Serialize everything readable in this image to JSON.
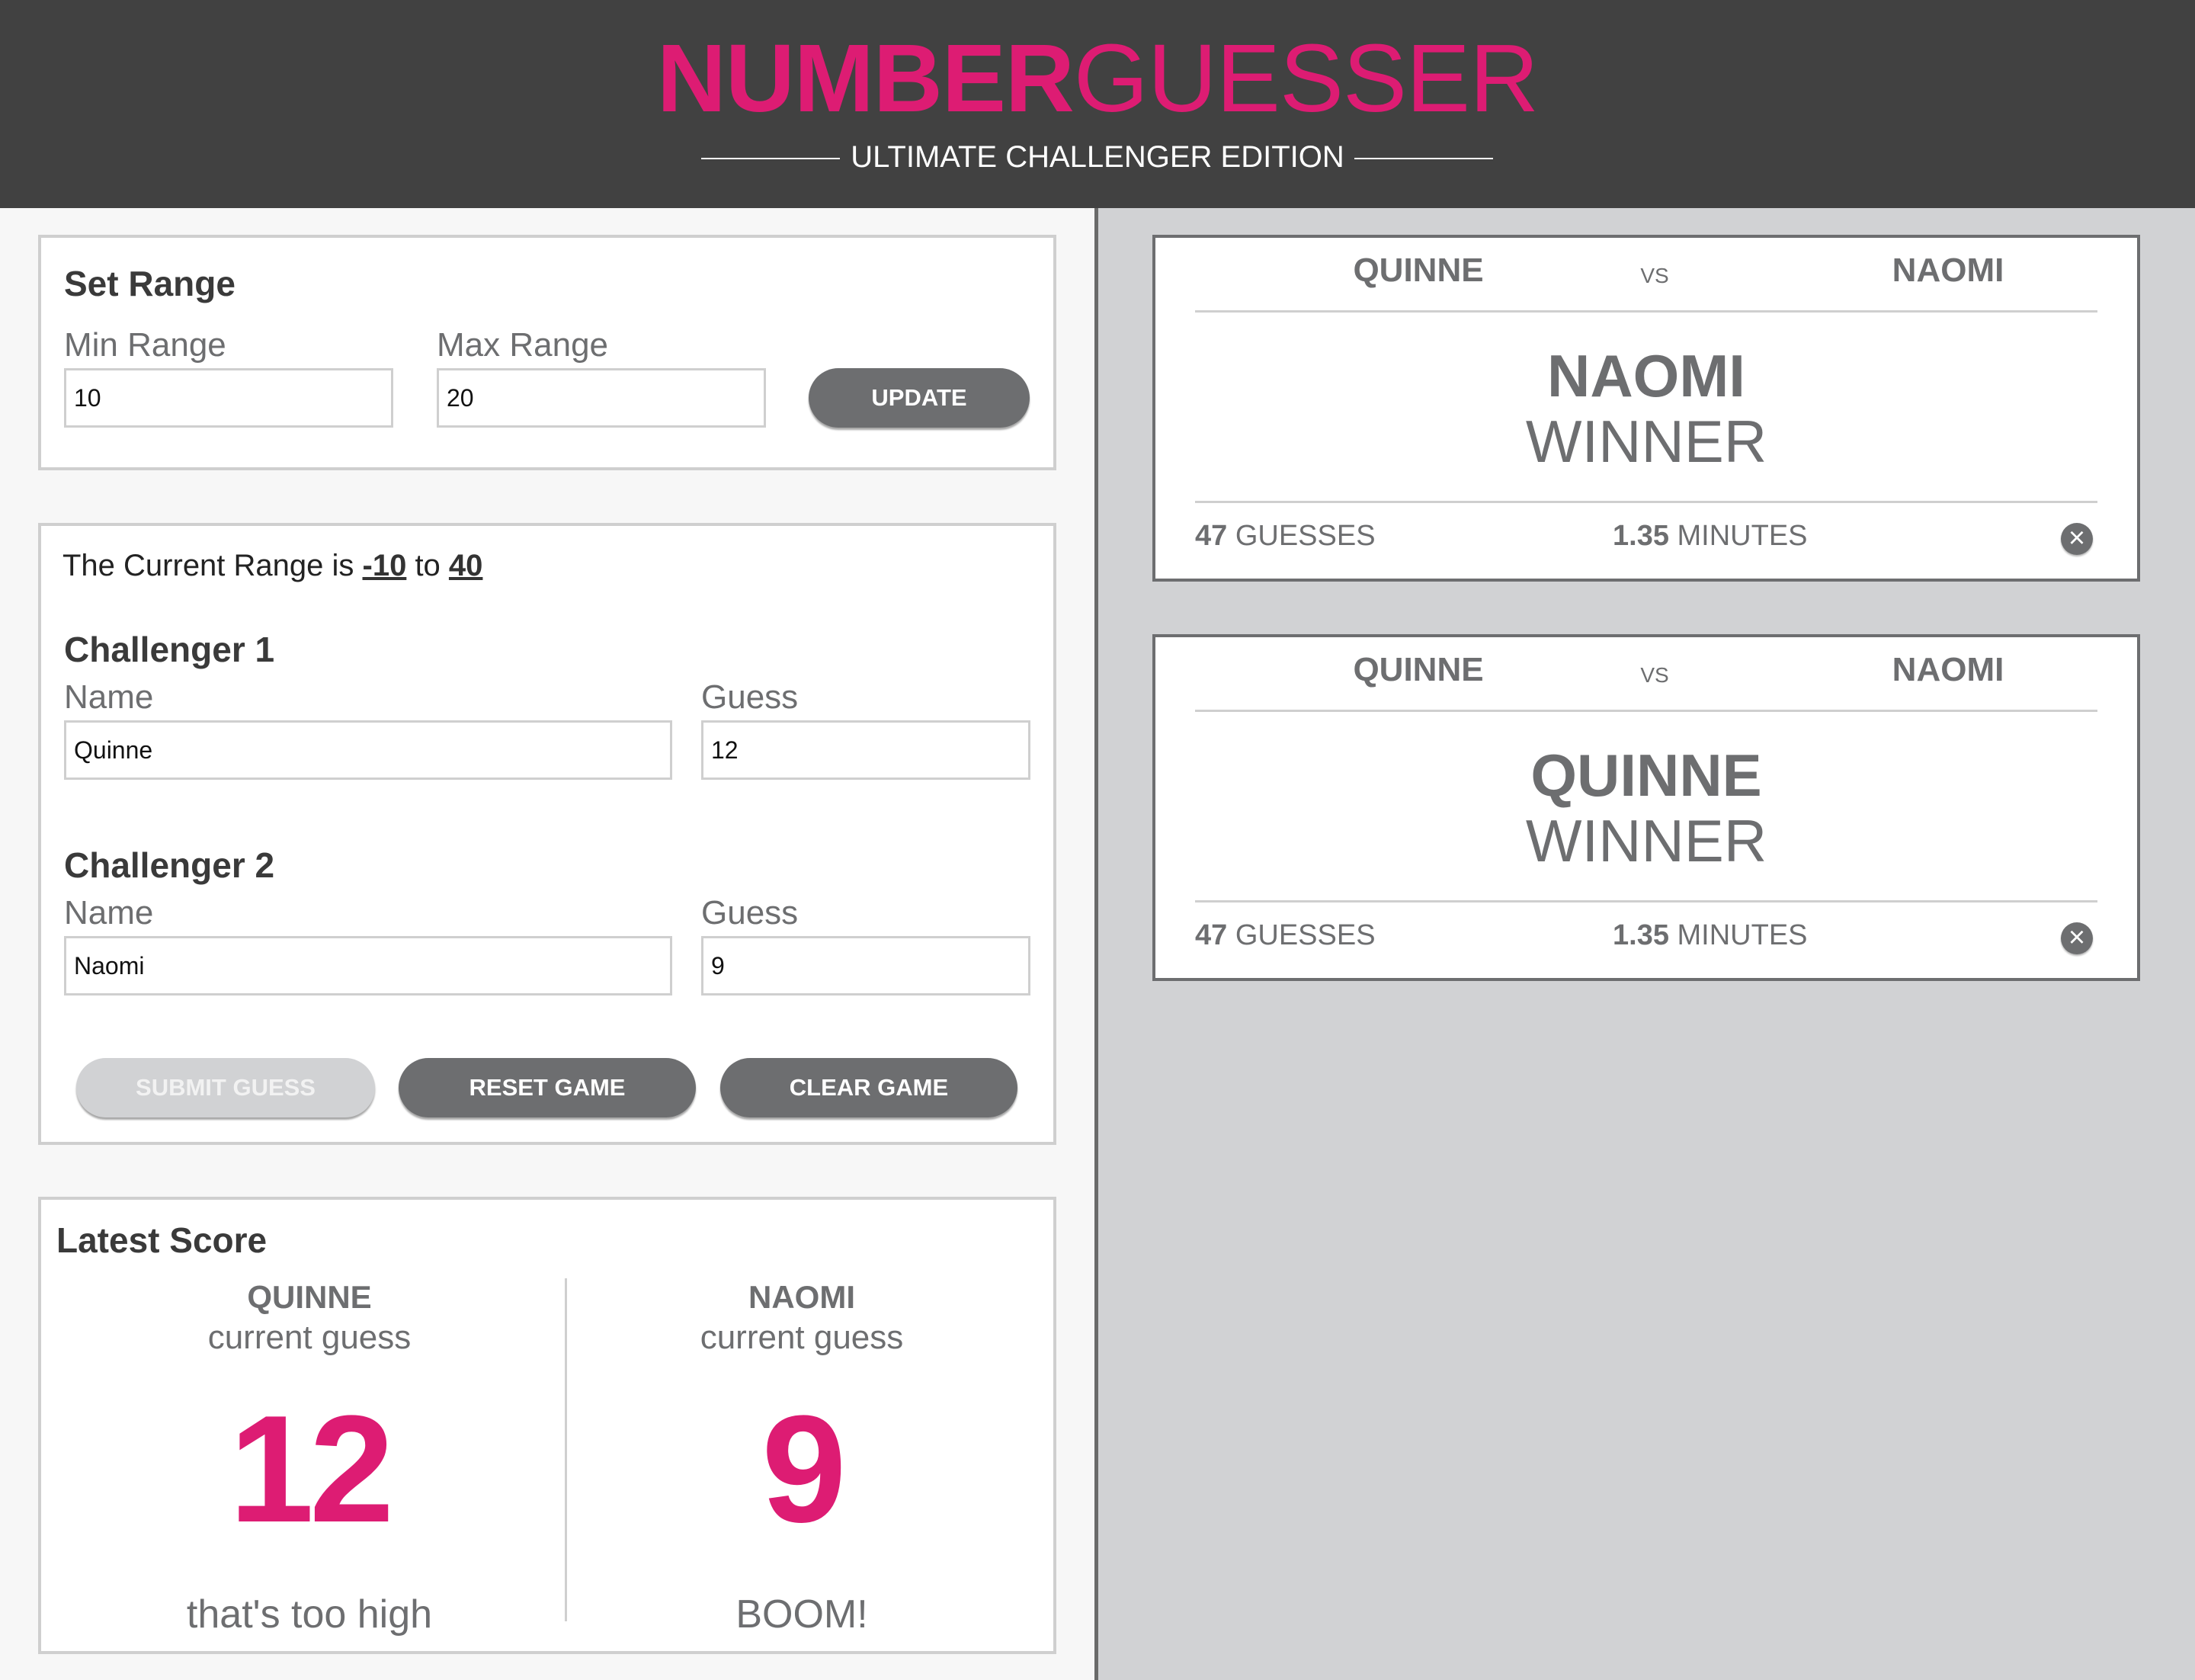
{
  "header": {
    "title_bold": "NUMBER",
    "title_light": "GUESSER",
    "subtitle": "ULTIMATE CHALLENGER EDITION"
  },
  "colors": {
    "accent": "#dd1c73",
    "header_bg": "#414141",
    "gray": "#6d6e70",
    "right_bg": "#d1d2d4"
  },
  "set_range": {
    "title": "Set Range",
    "min_label": "Min Range",
    "min_value": "10",
    "max_label": "Max Range",
    "max_value": "20",
    "update_label": "UPDATE"
  },
  "challenge": {
    "current_prefix": "The Current Range is ",
    "range_min": "-10",
    "range_to": " to ",
    "range_max": "40",
    "c1_title": "Challenger 1",
    "c1_name_label": "Name",
    "c1_name": "Quinne",
    "c1_guess_label": "Guess",
    "c1_guess": "12",
    "c2_title": "Challenger 2",
    "c2_name_label": "Name",
    "c2_name": "Naomi",
    "c2_guess_label": "Guess",
    "c2_guess": "9",
    "submit_label": "SUBMIT GUESS",
    "reset_label": "RESET GAME",
    "clear_label": "CLEAR GAME"
  },
  "score": {
    "title": "Latest Score",
    "p1_name": "QUINNE",
    "p1_sub": "current guess",
    "p1_number": "12",
    "p1_feedback": "that's too high",
    "p2_name": "NAOMI",
    "p2_sub": "current guess",
    "p2_number": "9",
    "p2_feedback": "BOOM!"
  },
  "results": [
    {
      "player1": "QUINNE",
      "vs": "VS",
      "player2": "NAOMI",
      "winner_name": "NAOMI",
      "winner_label": "WINNER",
      "guesses": "47",
      "guesses_label": " GUESSES",
      "minutes": "1.35",
      "minutes_label": " MINUTES",
      "close_icon": "close-icon"
    },
    {
      "player1": "QUINNE",
      "vs": "VS",
      "player2": "NAOMI",
      "winner_name": "QUINNE",
      "winner_label": "WINNER",
      "guesses": "47",
      "guesses_label": " GUESSES",
      "minutes": "1.35",
      "minutes_label": " MINUTES",
      "close_icon": "close-icon"
    }
  ]
}
